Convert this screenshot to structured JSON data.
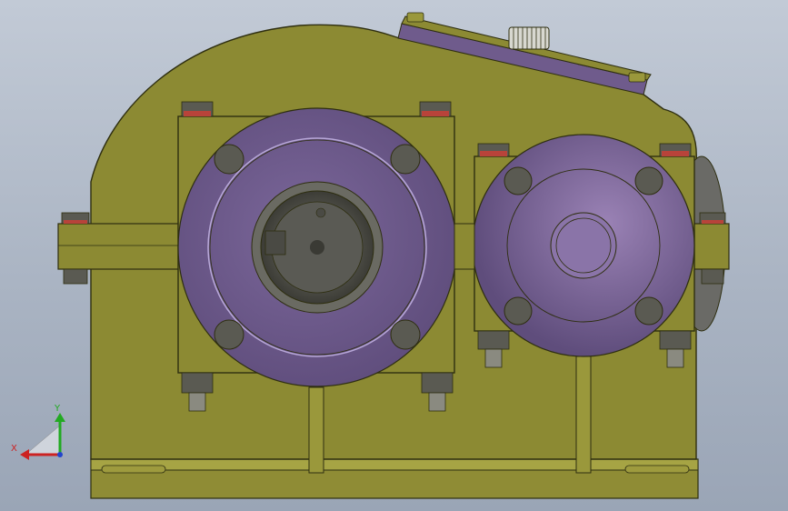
{
  "viewport": {
    "background_top": "#c2cad6",
    "background_bottom": "#9aa5b6"
  },
  "model": {
    "housing_color": "#8c8a33",
    "housing_dark": "#6f6d24",
    "cover_color": "#6f5b8c",
    "cover_light": "#8a74a8",
    "bolt_color": "#5a5a52",
    "seal_color": "#b8433a"
  },
  "triad": {
    "x_label": "X",
    "y_label": "Y",
    "x_color": "#cc2222",
    "y_color": "#22aa22"
  }
}
